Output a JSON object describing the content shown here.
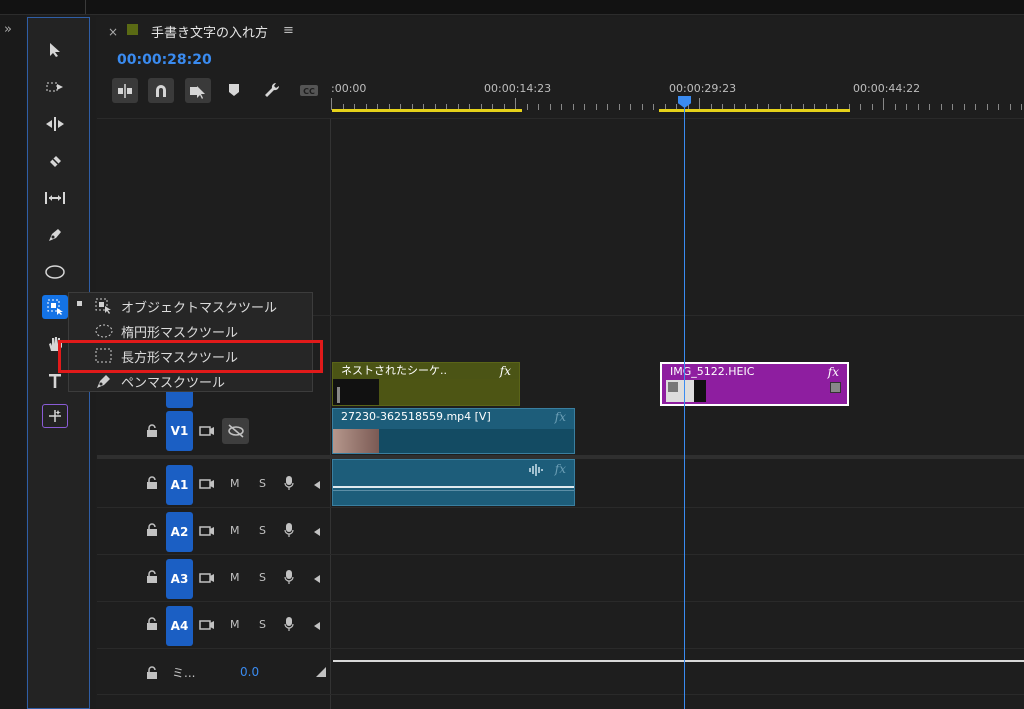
{
  "sequence": {
    "tab_close": "×",
    "title": "手書き文字の入れ方",
    "menu_icon": "≡",
    "timecode": "00:00:28:20"
  },
  "toolbar_icons": [
    "snap-insert-icon",
    "magnet-icon",
    "linked-selection-icon",
    "marker-icon",
    "wrench-icon",
    "captions-icon"
  ],
  "ruler": {
    "labels": [
      ":00:00",
      "00:00:14:23",
      "00:00:29:23",
      "00:00:44:22"
    ]
  },
  "tools": [
    "selection-tool",
    "track-select-forward-tool",
    "ripple-edit-tool",
    "razor-tool",
    "slip-tool",
    "pen-tool",
    "ellipse-tool",
    "object-mask-tool",
    "hand-tool",
    "type-tool",
    "generative-extend-tool"
  ],
  "flyout_menu": {
    "items": [
      {
        "label": "オブジェクトマスクツール",
        "icon": "object-mask-icon",
        "checked": true
      },
      {
        "label": "楕円形マスクツール",
        "icon": "ellipse-mask-icon",
        "checked": false
      },
      {
        "label": "長方形マスクツール",
        "icon": "rectangle-mask-icon",
        "checked": false,
        "highlighted": true
      },
      {
        "label": "ペンマスクツール",
        "icon": "pen-mask-icon",
        "checked": false
      }
    ]
  },
  "tracks": {
    "video": [
      {
        "name": "V1"
      }
    ],
    "audio": [
      {
        "name": "A1",
        "m": "M",
        "s": "S"
      },
      {
        "name": "A2",
        "m": "M",
        "s": "S"
      },
      {
        "name": "A3",
        "m": "M",
        "s": "S"
      },
      {
        "name": "A4",
        "m": "M",
        "s": "S"
      }
    ],
    "mix": {
      "label": "ミ...",
      "value": "0.0"
    }
  },
  "clips": {
    "nested": {
      "label": "ネストされたシーケ..",
      "fx": "fx",
      "color": "#4b5415"
    },
    "image": {
      "label": "IMG_5122.HEIC",
      "fx": "fx",
      "color": "#8e1ea0"
    },
    "video": {
      "label": "27230-362518559.mp4 [V]",
      "fx": "fx",
      "color": "#1d5d7a"
    },
    "audio": {
      "fx": "fx",
      "color": "#1d5d7a"
    }
  },
  "colors": {
    "accent": "#1473e6",
    "playhead": "#3a8bf0",
    "highlight": "#e11a1a",
    "work_area": "#e6d21a"
  }
}
